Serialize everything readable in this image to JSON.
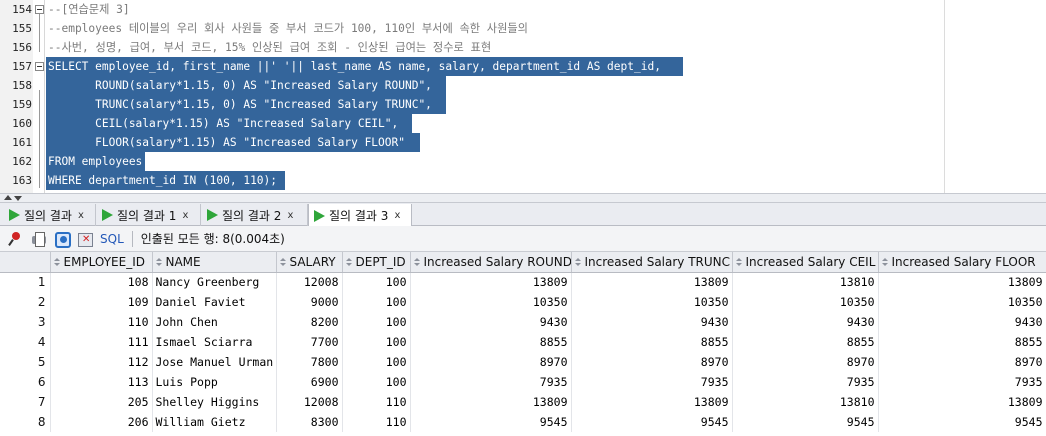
{
  "editor": {
    "lines": [
      {
        "n": "154",
        "text": "--[연습문제 3]",
        "cls": "comment",
        "fold": true
      },
      {
        "n": "155",
        "text": "--employees 테이블의 우리 회사 사원들 중 부서 코드가 100, 110인 부서에 속한 사원들의",
        "cls": "comment"
      },
      {
        "n": "156",
        "text": "--사번, 성명, 급여, 부서 코드, 15% 인상된 급여 조회 - 인상된 급여는 정수로 표현",
        "cls": "comment"
      },
      {
        "n": "157",
        "text": "SELECT employee_id, first_name ||' '|| last_name AS name, salary, department_id AS dept_id,",
        "cls": "sel",
        "fold": true
      },
      {
        "n": "158",
        "text": "       ROUND(salary*1.15, 0) AS \"Increased Salary ROUND\",",
        "cls": "sel"
      },
      {
        "n": "159",
        "text": "       TRUNC(salary*1.15, 0) AS \"Increased Salary TRUNC\",",
        "cls": "sel"
      },
      {
        "n": "160",
        "text": "       CEIL(salary*1.15) AS \"Increased Salary CEIL\",",
        "cls": "sel"
      },
      {
        "n": "161",
        "text": "       FLOOR(salary*1.15) AS \"Increased Salary FLOOR\"",
        "cls": "sel"
      },
      {
        "n": "162",
        "text": "FROM employees",
        "cls": "sel"
      },
      {
        "n": "163",
        "text": "WHERE department_id IN (100, 110);",
        "cls": "sel"
      }
    ]
  },
  "tabs": [
    {
      "label": "질의 결과",
      "close": "x"
    },
    {
      "label": "질의 결과 1",
      "close": "x"
    },
    {
      "label": "질의 결과 2",
      "close": "x"
    },
    {
      "label": "질의 결과 3",
      "close": "x",
      "active": true
    }
  ],
  "toolbar": {
    "sql_label": "SQL",
    "status": "인출된 모든 행: 8(0.004초)"
  },
  "grid": {
    "columns": [
      "EMPLOYEE_ID",
      "NAME",
      "SALARY",
      "DEPT_ID",
      "Increased Salary ROUND",
      "Increased Salary TRUNC",
      "Increased Salary CEIL",
      "Increased Salary FLOOR"
    ],
    "rows": [
      {
        "num": "1",
        "cells": [
          "108",
          "Nancy Greenberg",
          "12008",
          "100",
          "13809",
          "13809",
          "13810",
          "13809"
        ]
      },
      {
        "num": "2",
        "cells": [
          "109",
          "Daniel Faviet",
          "9000",
          "100",
          "10350",
          "10350",
          "10350",
          "10350"
        ]
      },
      {
        "num": "3",
        "cells": [
          "110",
          "John Chen",
          "8200",
          "100",
          "9430",
          "9430",
          "9430",
          "9430"
        ]
      },
      {
        "num": "4",
        "cells": [
          "111",
          "Ismael Sciarra",
          "7700",
          "100",
          "8855",
          "8855",
          "8855",
          "8855"
        ]
      },
      {
        "num": "5",
        "cells": [
          "112",
          "Jose Manuel Urman",
          "7800",
          "100",
          "8970",
          "8970",
          "8970",
          "8970"
        ]
      },
      {
        "num": "6",
        "cells": [
          "113",
          "Luis Popp",
          "6900",
          "100",
          "7935",
          "7935",
          "7935",
          "7935"
        ]
      },
      {
        "num": "7",
        "cells": [
          "205",
          "Shelley Higgins",
          "12008",
          "110",
          "13809",
          "13809",
          "13810",
          "13809"
        ]
      },
      {
        "num": "8",
        "cells": [
          "206",
          "William Gietz",
          "8300",
          "110",
          "9545",
          "9545",
          "9545",
          "9545"
        ]
      }
    ]
  }
}
